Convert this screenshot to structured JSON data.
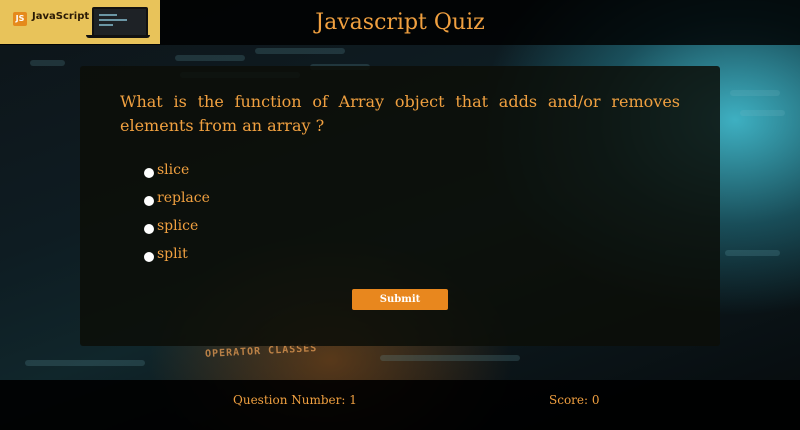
{
  "header": {
    "logo_text": "JavaScript",
    "logo_badge": "JS",
    "title": "Javascript Quiz"
  },
  "background": {
    "caption": "OPERATOR CLASSES"
  },
  "quiz": {
    "question": "What is the function of Array object that adds and/or removes elements from an array ?",
    "options": [
      {
        "label": "slice",
        "selected": false
      },
      {
        "label": "replace",
        "selected": false
      },
      {
        "label": "splice",
        "selected": false
      },
      {
        "label": "split",
        "selected": false
      }
    ],
    "submit_label": "Submit"
  },
  "footer": {
    "question_number_text": "Question Number: 1",
    "score_text": "Score: 0"
  },
  "colors": {
    "accent": "#f0a040",
    "button": "#e8871e",
    "logo_bg": "#e8c35a"
  },
  "icons": {
    "logo": "javascript-logo-icon",
    "laptop": "laptop-icon",
    "radio": "radio-button-icon"
  }
}
